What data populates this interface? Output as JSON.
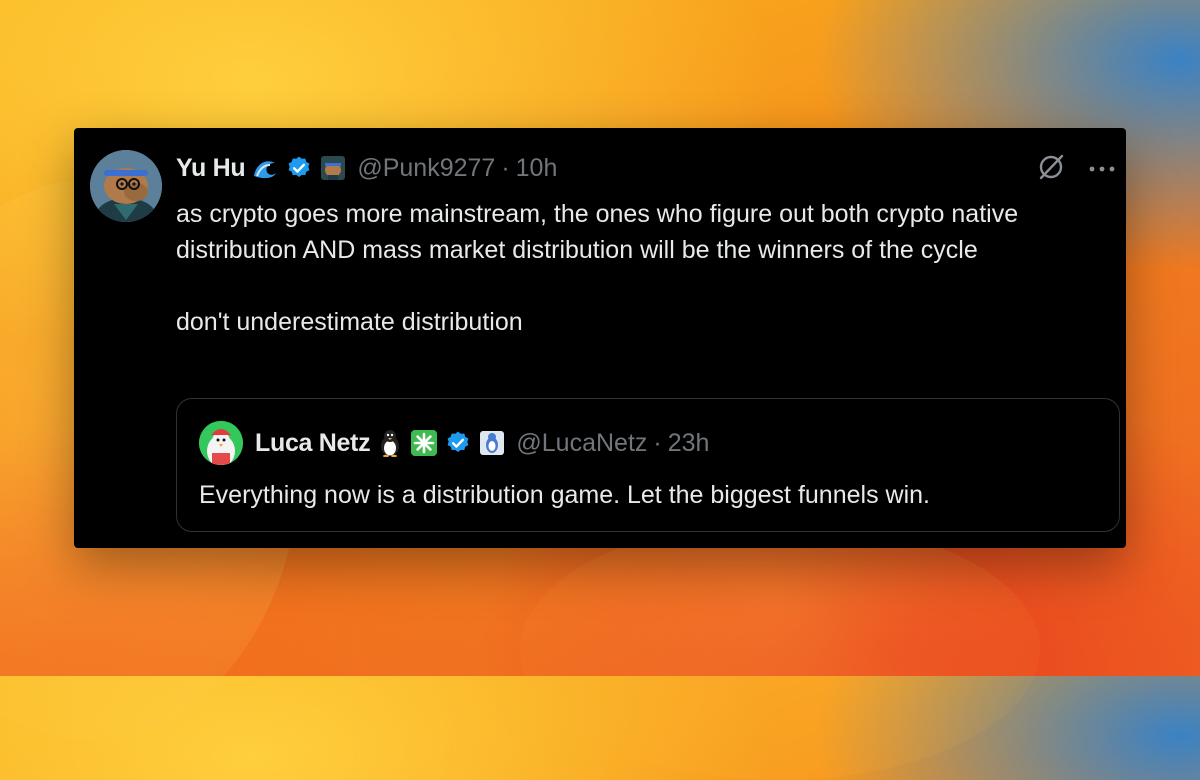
{
  "tweet": {
    "author_name": "Yu Hu",
    "author_handle": "@Punk9277",
    "separator": "·",
    "time": "10h",
    "text_paragraph_1": "as crypto goes more mainstream, the ones who figure out both crypto native distribution AND mass market distribution will be the winners of the cycle",
    "text_paragraph_2": "don't underestimate distribution",
    "author_emoji": "🌊",
    "icons": [
      "wave-emoji-icon",
      "verified-badge-icon",
      "affiliate-badge-icon",
      "grok-icon",
      "more-icon"
    ]
  },
  "quote": {
    "author_name": "Luca Netz",
    "author_handle": "@LucaNetz",
    "separator": "·",
    "time": "23h",
    "text": "Everything now is a distribution game. Let the biggest funnels win.",
    "author_emojis": [
      "🐧",
      "✳️"
    ],
    "icons": [
      "penguin-emoji-icon",
      "sparkle-emoji-icon",
      "verified-badge-icon",
      "affiliate-badge-icon"
    ]
  },
  "colors": {
    "card_background": "#000000",
    "primary_text": "#e7e9ea",
    "secondary_text": "#71767b",
    "verified_blue": "#1d9bf0",
    "border": "#2f3336"
  }
}
